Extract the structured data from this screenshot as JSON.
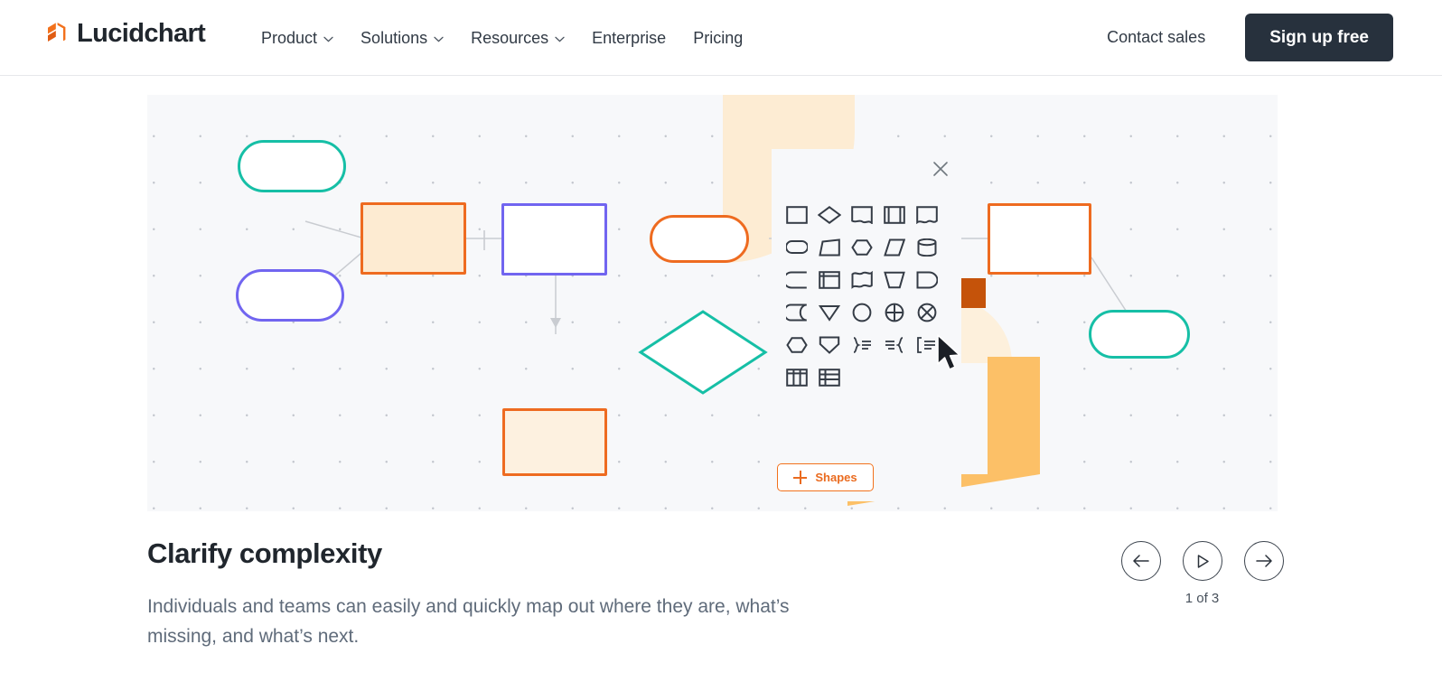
{
  "brand": {
    "name": "Lucidchart",
    "logo_icon": "lucid-cube-logo-icon",
    "logo_color": "#f2711c"
  },
  "header": {
    "nav_items": [
      {
        "label": "Product",
        "has_dropdown": true,
        "icon": "chevron-down-icon"
      },
      {
        "label": "Solutions",
        "has_dropdown": true,
        "icon": "chevron-down-icon"
      },
      {
        "label": "Resources",
        "has_dropdown": true,
        "icon": "chevron-down-icon"
      },
      {
        "label": "Enterprise",
        "has_dropdown": false
      },
      {
        "label": "Pricing",
        "has_dropdown": false
      }
    ],
    "contact_sales_label": "Contact sales",
    "signup_label": "Sign up free",
    "signup_bg": "#27313d"
  },
  "canvas": {
    "background": "#f7f8fa",
    "grid_dot_color": "#c3c7ce",
    "decorations": [
      {
        "name": "quarter-circle-cream",
        "color": "#fdecd3"
      },
      {
        "name": "quarter-circle-cream-2",
        "color": "#fdf0dc"
      },
      {
        "name": "orange-l-polygon",
        "color": "#fcc067"
      },
      {
        "name": "dark-orange-cross",
        "color": "#c5530a"
      }
    ],
    "nodes": [
      {
        "id": "n1",
        "shape": "pill",
        "stroke": "#16bfa6",
        "fill": "#ffffff"
      },
      {
        "id": "n2",
        "shape": "pill",
        "stroke": "#7165f0",
        "fill": "#ffffff"
      },
      {
        "id": "n3",
        "shape": "rect",
        "stroke": "#ee6b20",
        "fill": "#fdebd2"
      },
      {
        "id": "n4",
        "shape": "rect",
        "stroke": "#7165f0",
        "fill": "#ffffff"
      },
      {
        "id": "n5",
        "shape": "pill",
        "stroke": "#ee6b20",
        "fill": "#ffffff"
      },
      {
        "id": "n6",
        "shape": "diamond",
        "stroke": "#16bfa6",
        "fill": "#ffffff"
      },
      {
        "id": "n7",
        "shape": "rect",
        "stroke": "#ee6b20",
        "fill": "#fdf1e0"
      },
      {
        "id": "n8",
        "shape": "rect",
        "stroke": "#ee6b20",
        "fill": "#ffffff"
      },
      {
        "id": "n9",
        "shape": "pill",
        "stroke": "#16bfa6",
        "fill": "#ffffff"
      }
    ]
  },
  "shape_panel": {
    "background": "#f7f8fa",
    "close_icon": "close-icon",
    "cursor_icon": "mouse-pointer-arrow-icon",
    "shapes_button": {
      "label": "Shapes",
      "icon": "plus-icon",
      "color": "#ea6b1f"
    },
    "shapes": [
      {
        "name": "rectangle-shape"
      },
      {
        "name": "diamond-shape"
      },
      {
        "name": "note-shape"
      },
      {
        "name": "predefined-process-shape"
      },
      {
        "name": "document-shape"
      },
      {
        "name": "rounded-terminator-shape"
      },
      {
        "name": "trapezoid-shape"
      },
      {
        "name": "hexagon-shape"
      },
      {
        "name": "parallelogram-shape"
      },
      {
        "name": "cylinder-shape"
      },
      {
        "name": "delay-shape"
      },
      {
        "name": "internal-storage-shape"
      },
      {
        "name": "multi-document-shape"
      },
      {
        "name": "manual-operation-shape"
      },
      {
        "name": "display-shape"
      },
      {
        "name": "stored-data-shape"
      },
      {
        "name": "merge-triangle-shape"
      },
      {
        "name": "circle-connector-shape"
      },
      {
        "name": "summing-junction-shape"
      },
      {
        "name": "or-junction-shape"
      },
      {
        "name": "preparation-shape"
      },
      {
        "name": "extract-shape"
      },
      {
        "name": "brace-right-list-shape"
      },
      {
        "name": "brace-left-list-shape"
      },
      {
        "name": "bracket-list-shape"
      },
      {
        "name": "table-columns-shape"
      },
      {
        "name": "table-rows-shape"
      }
    ]
  },
  "caption": {
    "title": "Clarify complexity",
    "body": "Individuals and teams can easily and quickly map out where they are, what’s missing, and what’s next."
  },
  "carousel": {
    "prev_label": "prev-arrow-icon",
    "play_label": "play-icon",
    "next_label": "next-arrow-icon",
    "counter": "1 of 3"
  }
}
